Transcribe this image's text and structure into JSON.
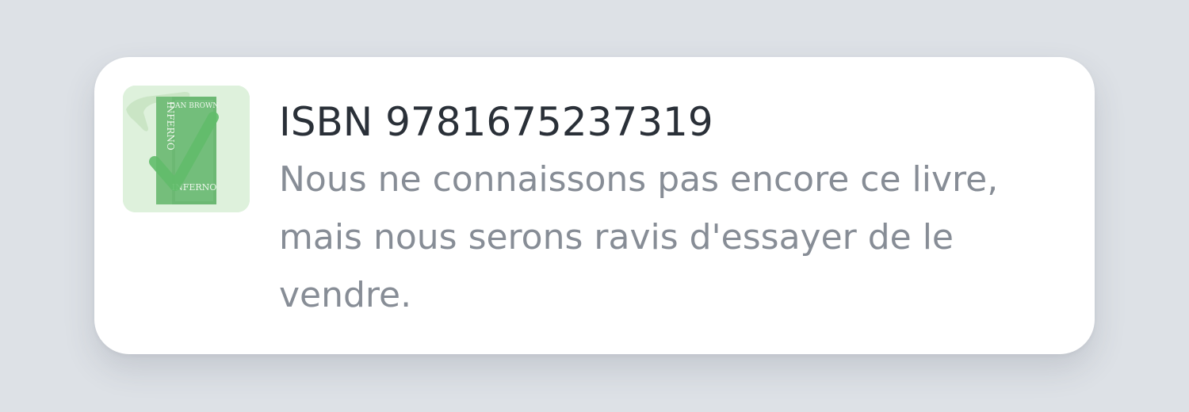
{
  "notification": {
    "isbn_line": "ISBN 9781675237319",
    "message": "Nous ne connaissons pas encore ce livre, mais nous serons ravis d'essayer de le vendre.",
    "thumbnail": {
      "book_author": "DAN BROWN",
      "book_title": "INFERNO",
      "spine_title": "INFERNO",
      "overlay_icon": "checkmark-icon"
    },
    "colors": {
      "overlay_green": "#3fae4a",
      "title_text": "#2a3038",
      "message_text": "#878d96",
      "background": "#dde1e6"
    }
  }
}
